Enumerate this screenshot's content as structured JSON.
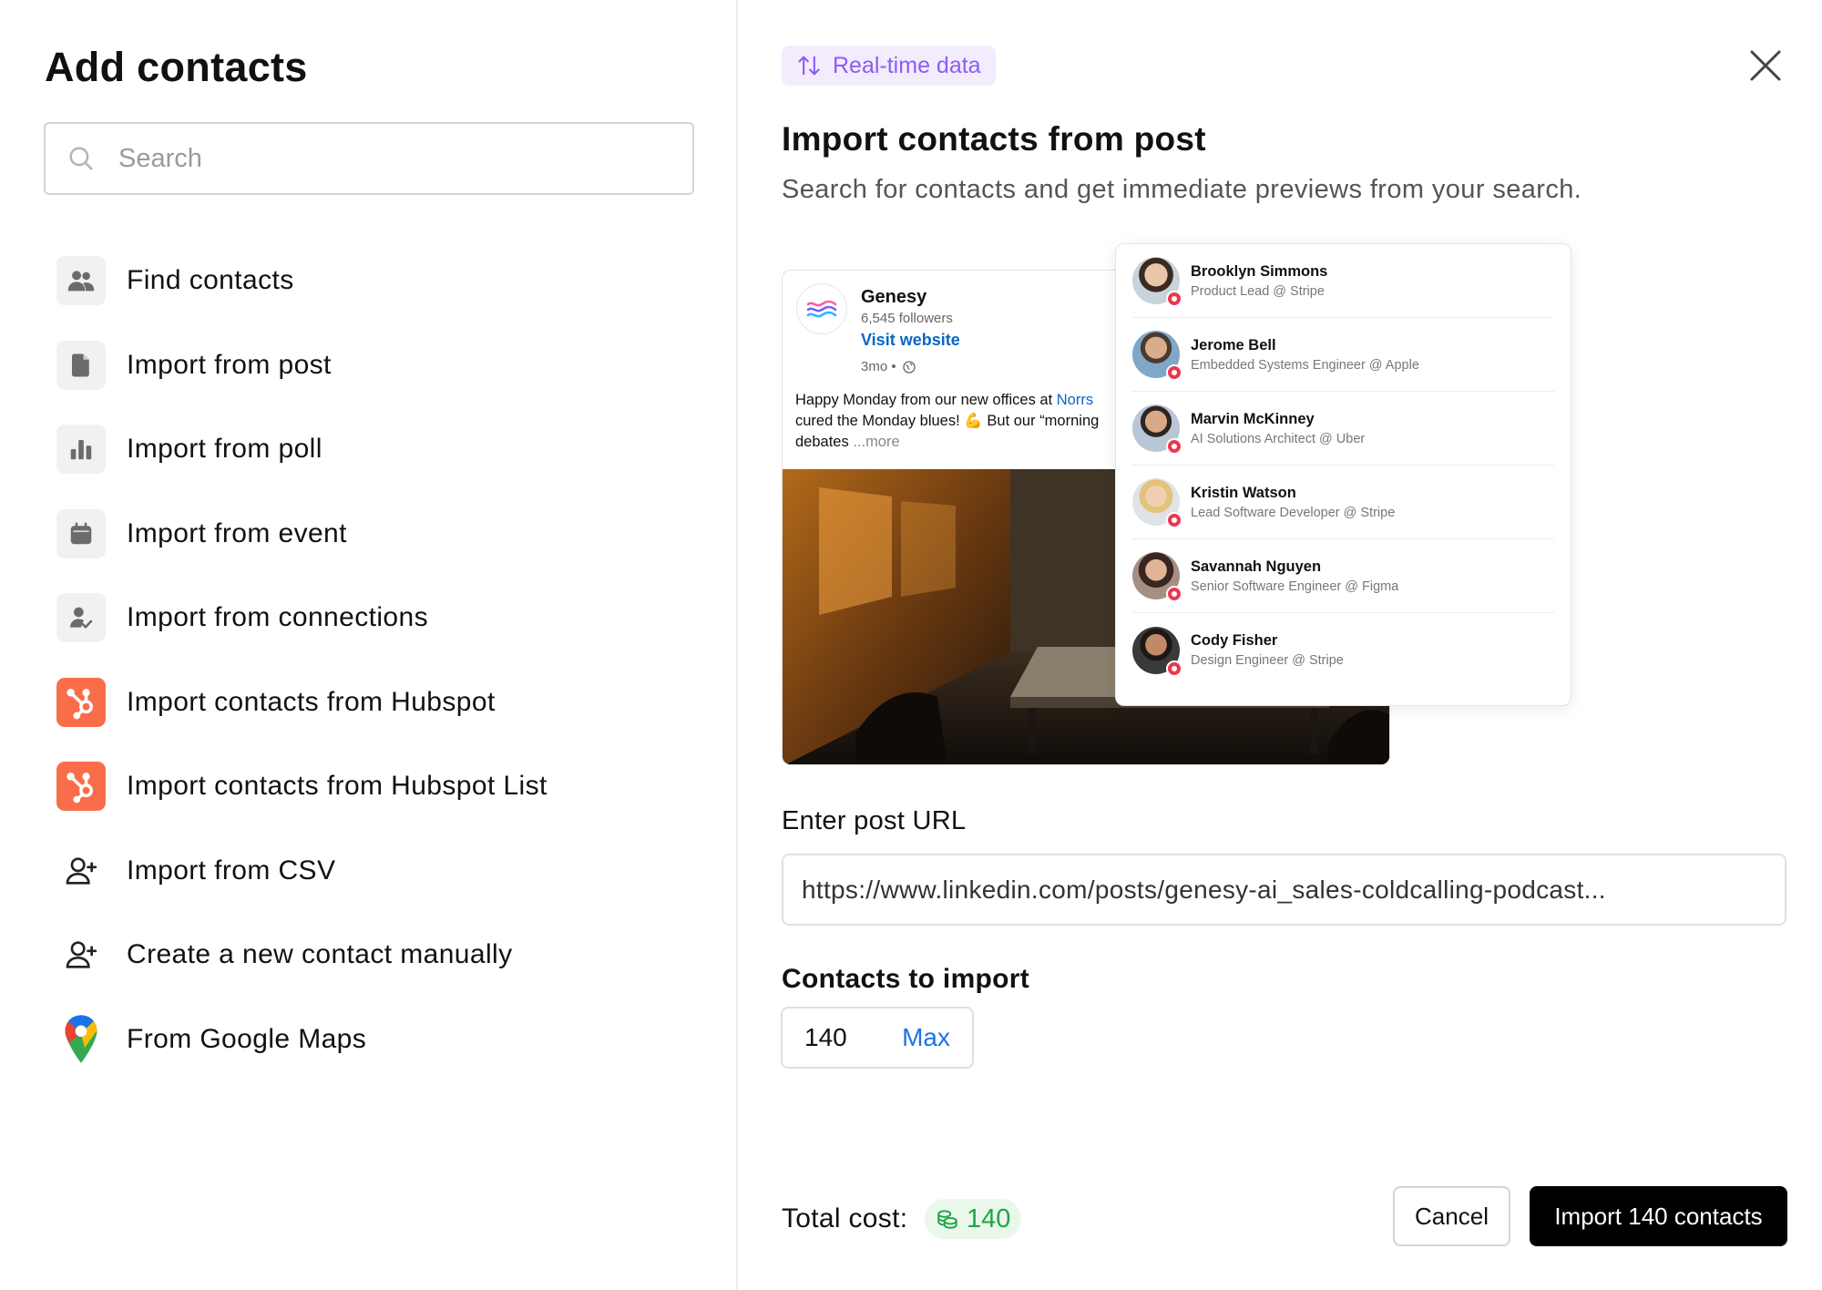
{
  "sidebar": {
    "title": "Add contacts",
    "search_placeholder": "Search",
    "items": [
      {
        "label": "Find contacts",
        "icon": "users-icon"
      },
      {
        "label": "Import from post",
        "icon": "document-icon"
      },
      {
        "label": "Import from poll",
        "icon": "bar-chart-icon"
      },
      {
        "label": "Import from event",
        "icon": "calendar-icon"
      },
      {
        "label": "Import from connections",
        "icon": "user-check-icon"
      },
      {
        "label": "Import contacts from Hubspot",
        "icon": "hubspot-icon"
      },
      {
        "label": "Import contacts from Hubspot List",
        "icon": "hubspot-icon"
      },
      {
        "label": "Import from CSV",
        "icon": "user-plus-icon"
      },
      {
        "label": "Create a new contact manually",
        "icon": "user-plus-icon"
      },
      {
        "label": "From Google Maps",
        "icon": "google-maps-pin-icon"
      }
    ]
  },
  "panel": {
    "badge": "Real-time data",
    "title": "Import contacts from post",
    "subtitle": "Search for contacts and get immediate previews from your search.",
    "post": {
      "company": "Genesy",
      "followers": "6,545 followers",
      "visit": "Visit website",
      "time": "3mo •",
      "line1": "Happy Monday from our new offices at ",
      "mention": "Norrs",
      "line2": "cured the Monday blues! 💪  But our “morning",
      "line3": "debates ",
      "more": "...more"
    },
    "people": [
      {
        "name": "Brooklyn Simmons",
        "role": "Product Lead @ Stripe"
      },
      {
        "name": "Jerome Bell",
        "role": "Embedded Systems Engineer @ Apple"
      },
      {
        "name": "Marvin McKinney",
        "role": "AI Solutions Architect @ Uber"
      },
      {
        "name": "Kristin Watson",
        "role": "Lead Software Developer @ Stripe"
      },
      {
        "name": "Savannah Nguyen",
        "role": "Senior Software Engineer @ Figma"
      },
      {
        "name": "Cody Fisher",
        "role": "Design Engineer @ Stripe"
      }
    ],
    "url_label": "Enter post URL",
    "url_value": "https://www.linkedin.com/posts/genesy-ai_sales-coldcalling-podcast...",
    "count_label": "Contacts to import",
    "count_value": "140",
    "count_max": "Max",
    "total_label": "Total cost:",
    "total_value": "140",
    "cancel": "Cancel",
    "import": "Import 140 contacts"
  },
  "colors": {
    "accent_purple": "#8b5cf6",
    "hubspot_orange": "#fa6d4a",
    "link_blue": "#1a73e8",
    "cost_green": "#22a447",
    "primary_button": "#000000"
  }
}
